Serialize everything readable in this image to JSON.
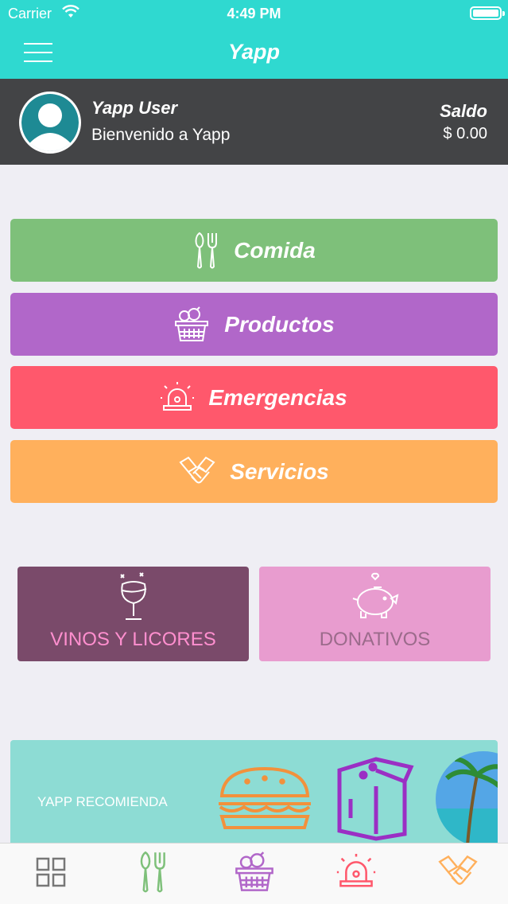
{
  "status_bar": {
    "carrier": "Carrier",
    "time": "4:49 PM"
  },
  "nav": {
    "title": "Yapp",
    "menu_icon": "hamburger-menu-icon"
  },
  "profile": {
    "name": "Yapp User",
    "welcome": "Bienvenido a Yapp",
    "saldo_label": "Saldo",
    "saldo_value": "$ 0.00"
  },
  "categories": [
    {
      "label": "Comida",
      "icon": "utensils-icon",
      "color": "#7ec07a"
    },
    {
      "label": "Productos",
      "icon": "basket-icon",
      "color": "#b167c9"
    },
    {
      "label": "Emergencias",
      "icon": "siren-icon",
      "color": "#ff586c"
    },
    {
      "label": "Servicios",
      "icon": "handshake-icon",
      "color": "#ffb05c"
    }
  ],
  "tiles": [
    {
      "label": "VINOS Y LICORES",
      "icon": "wine-glass-icon",
      "bg": "#7a4a6a",
      "fg": "#ff8fcf"
    },
    {
      "label": "DONATIVOS",
      "icon": "piggy-bank-icon",
      "bg": "#e89ccf",
      "fg": "#9b6b8b"
    }
  ],
  "recommend": {
    "label": "YAPP RECOMIENDA",
    "items": [
      "burger-icon",
      "bread-icon",
      "beach-logo"
    ]
  },
  "tabbar": [
    {
      "name": "home-grid-icon",
      "color": "#777777"
    },
    {
      "name": "utensils-icon",
      "color": "#7ec07a"
    },
    {
      "name": "basket-icon",
      "color": "#b167c9"
    },
    {
      "name": "siren-icon",
      "color": "#ff586c"
    },
    {
      "name": "handshake-icon",
      "color": "#ffb05c"
    }
  ]
}
